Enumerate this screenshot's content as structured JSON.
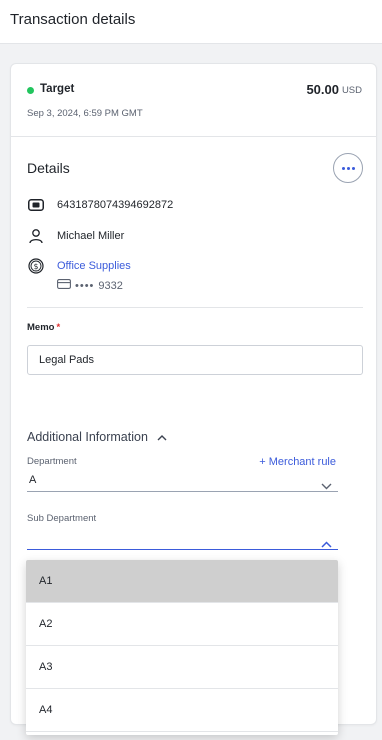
{
  "header": {
    "title": "Transaction details"
  },
  "summary": {
    "merchant": "Target",
    "amount": "50.00",
    "currency": "USD",
    "timestamp": "Sep 3, 2024, 6:59 PM GMT",
    "status_color": "#22c55e"
  },
  "details": {
    "title": "Details",
    "more_icon": "more-horizontal-icon",
    "transaction_id": "6431878074394692872",
    "user_name": "Michael Miller",
    "category": "Office Supplies",
    "card_mask": "••••",
    "card_last4": "9332"
  },
  "memo": {
    "label": "Memo",
    "required_mark": "*",
    "value": "Legal Pads"
  },
  "additional": {
    "title": "Additional Information",
    "merchant_rule": "+ Merchant rule",
    "department": {
      "label": "Department",
      "value": "A"
    },
    "sub_department": {
      "label": "Sub Department",
      "value": ""
    }
  },
  "dropdown": {
    "options": [
      "A1",
      "A2",
      "A3",
      "A4"
    ],
    "highlighted_index": 0
  },
  "colors": {
    "accent": "#3b5bdb",
    "required": "#e03131",
    "highlight": "#cfcfcf"
  }
}
